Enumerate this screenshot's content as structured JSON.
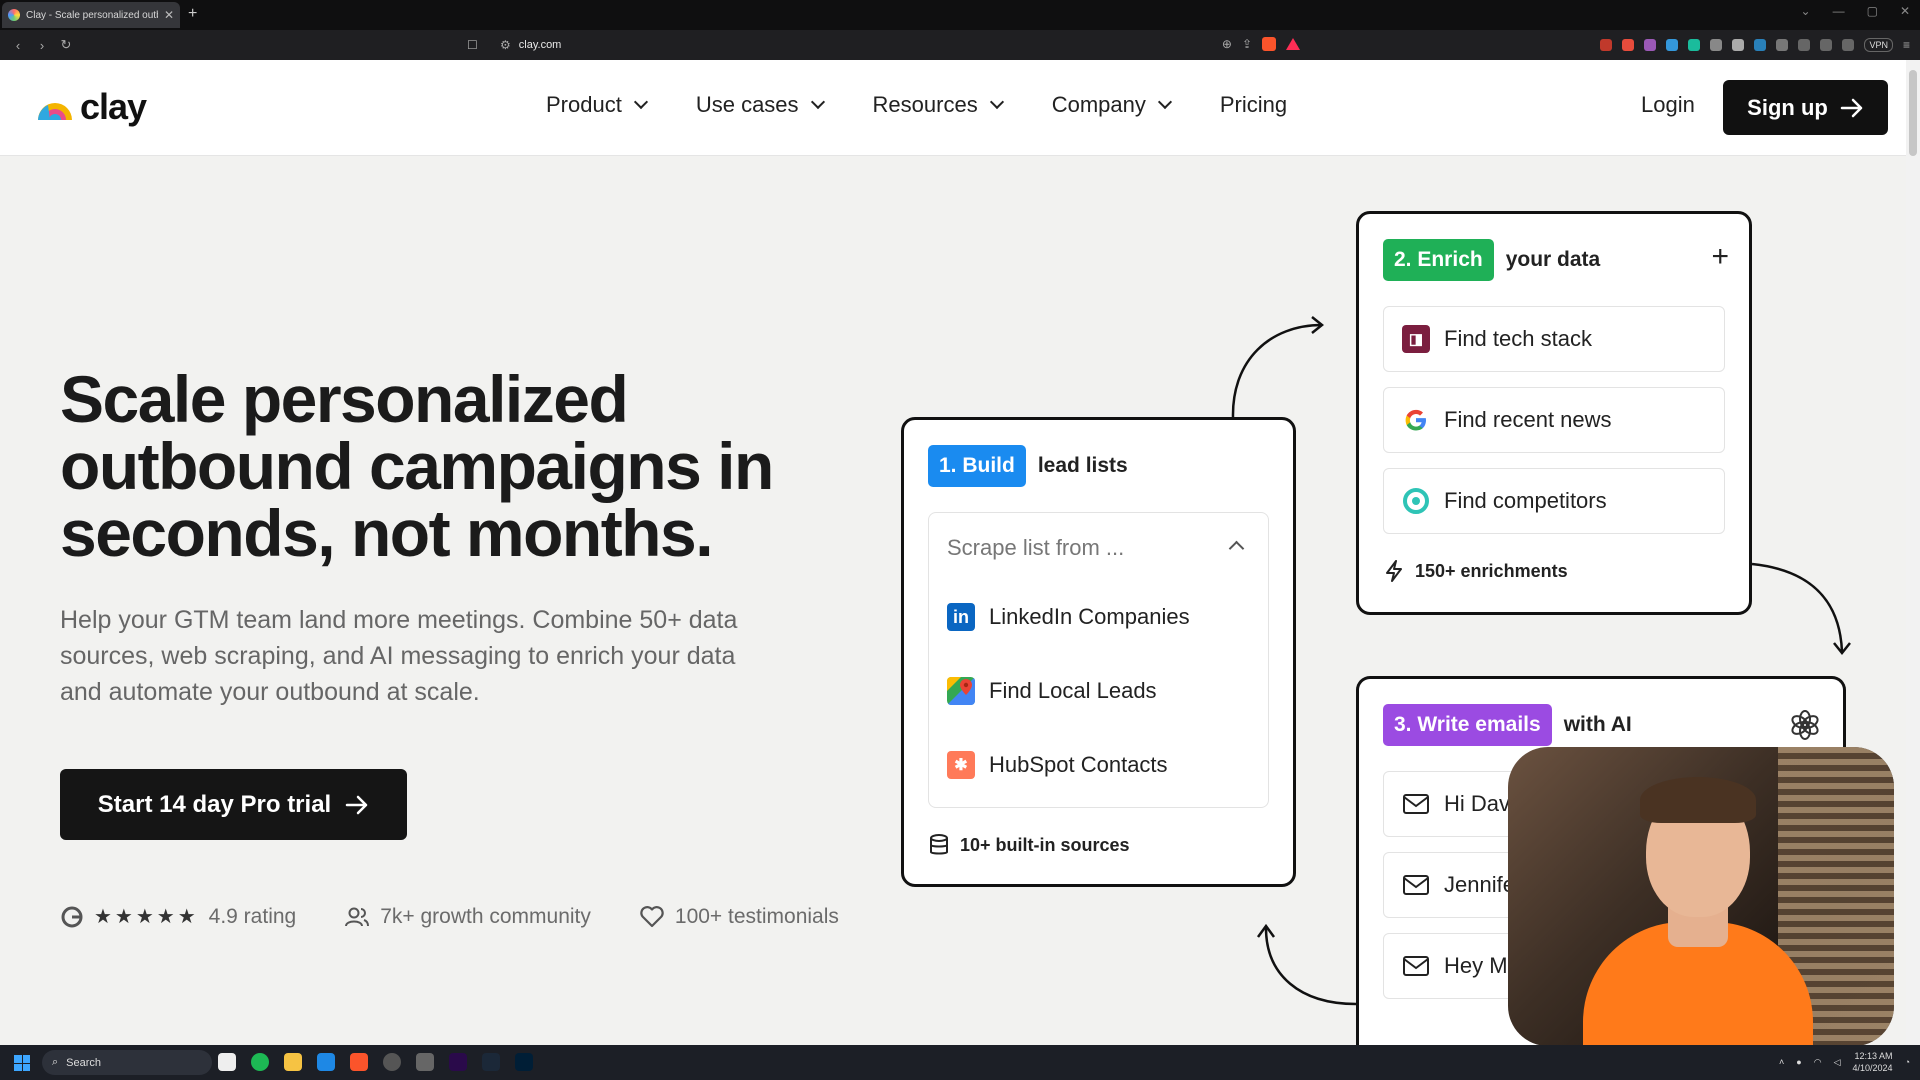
{
  "browser": {
    "tab_title": "Clay - Scale personalized outbo...",
    "url": "clay.com",
    "vpn_label": "VPN"
  },
  "header": {
    "logo_text": "clay",
    "nav": [
      {
        "label": "Product",
        "has_dropdown": true
      },
      {
        "label": "Use cases",
        "has_dropdown": true
      },
      {
        "label": "Resources",
        "has_dropdown": true
      },
      {
        "label": "Company",
        "has_dropdown": true
      },
      {
        "label": "Pricing",
        "has_dropdown": false
      }
    ],
    "login_label": "Login",
    "signup_label": "Sign up"
  },
  "hero": {
    "title": "Scale personalized outbound campaigns in seconds, not months.",
    "subtitle": "Help your GTM team land more meetings. Combine 50+ data sources, web scraping, and AI messaging to enrich your data and automate your outbound at scale.",
    "cta_label": "Start 14 day Pro trial",
    "trust": {
      "rating_label": "4.9 rating",
      "stars": 5,
      "community_label": "7k+ growth community",
      "testimonials_label": "100+ testimonials"
    }
  },
  "build_card": {
    "pill": "1. Build",
    "pill_color": "#1a8bf0",
    "heading_rest": "lead lists",
    "dropdown_placeholder": "Scrape list from ...",
    "sources": [
      {
        "label": "LinkedIn Companies",
        "icon": "linkedin-icon"
      },
      {
        "label": "Find Local Leads",
        "icon": "google-maps-icon"
      },
      {
        "label": "HubSpot Contacts",
        "icon": "hubspot-icon"
      }
    ],
    "footer": "10+ built-in sources"
  },
  "enrich_card": {
    "pill": "2. Enrich",
    "pill_color": "#1fb057",
    "heading_rest": "your data",
    "items": [
      {
        "label": "Find tech stack",
        "icon": "builtwith-icon"
      },
      {
        "label": "Find recent news",
        "icon": "google-icon"
      },
      {
        "label": "Find competitors",
        "icon": "ocean-icon"
      }
    ],
    "footer": "150+ enrichments"
  },
  "write_card": {
    "pill": "3. Write emails",
    "pill_color": "#9b4be2",
    "heading_rest": "with AI",
    "emails": [
      {
        "label": "Hi Dav"
      },
      {
        "label": "Jennife"
      },
      {
        "label": "Hey M"
      }
    ]
  },
  "taskbar": {
    "search_label": "Search",
    "time": "12:13 AM",
    "date": "4/10/2024"
  }
}
